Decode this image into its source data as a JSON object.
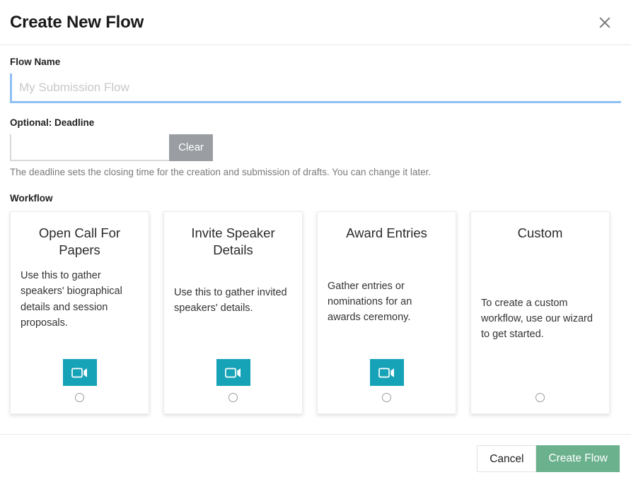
{
  "dialog": {
    "title": "Create New Flow",
    "close_icon": "close-icon"
  },
  "flow_name": {
    "label": "Flow Name",
    "value": "",
    "placeholder": "My Submission Flow"
  },
  "deadline": {
    "label": "Optional: Deadline",
    "value": "",
    "placeholder": "",
    "clear_label": "Clear",
    "help_text": "The deadline sets the closing time for the creation and submission of drafts. You can change it later."
  },
  "workflow": {
    "label": "Workflow",
    "cards": [
      {
        "title": "Open Call For Papers",
        "description": "Use this to gather speakers' biographical details and session proposals.",
        "icon": "video-camera-icon",
        "has_icon": true,
        "selected": false
      },
      {
        "title": "Invite Speaker Details",
        "description": "Use this to gather invited speakers' details.",
        "icon": "video-camera-icon",
        "has_icon": true,
        "selected": false
      },
      {
        "title": "Award Entries",
        "description": "Gather entries or nominations for an awards ceremony.",
        "icon": "video-camera-icon",
        "has_icon": true,
        "selected": false
      },
      {
        "title": "Custom",
        "description": "To create a custom workflow, use our wizard to get started.",
        "icon": "",
        "has_icon": false,
        "selected": false
      }
    ]
  },
  "footer": {
    "cancel_label": "Cancel",
    "create_label": "Create Flow"
  },
  "colors": {
    "accent_teal": "#16a3b7",
    "accent_green": "#6bb18d",
    "clear_gray": "#9a9ea3",
    "focus_blue": "#8fc0f5"
  }
}
